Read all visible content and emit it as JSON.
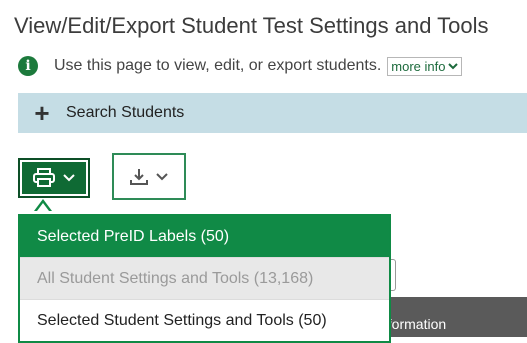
{
  "page": {
    "title": "View/Edit/Export Student Test Settings and Tools",
    "info_text": "Use this page to view, edit, or export students.",
    "more_info_label": "more info"
  },
  "search": {
    "label": "Search Students"
  },
  "toolbar": {
    "print_icon": "printer-icon",
    "download_icon": "download-icon"
  },
  "print_menu": {
    "items": [
      {
        "label": "Selected PreID Labels (50)",
        "state": "selected"
      },
      {
        "label": "All Student Settings and Tools (13,168)",
        "state": "disabled"
      },
      {
        "label": "Selected Student Settings and Tools (50)",
        "state": "normal"
      }
    ]
  },
  "background": {
    "partial_header": "nformation"
  },
  "colors": {
    "primary_green": "#0f6a34",
    "menu_highlight": "#108a46",
    "search_bar": "#c5dde5"
  }
}
